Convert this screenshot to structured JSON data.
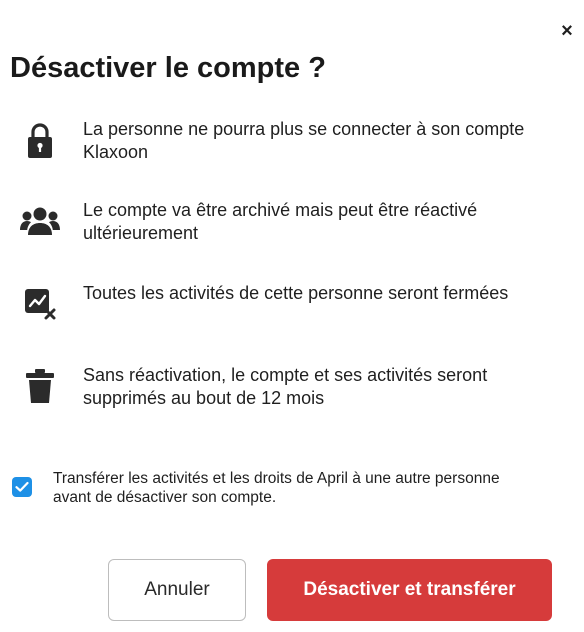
{
  "dialog": {
    "close_label": "×",
    "title": "Désactiver le compte ?",
    "items": [
      {
        "icon": "lock-icon",
        "text": "La personne ne pourra plus se connecter à son compte Klaxoon"
      },
      {
        "icon": "users-icon",
        "text": "Le compte va être archivé mais peut être réactivé ultérieurement"
      },
      {
        "icon": "activity-closed-icon",
        "text": "Toutes les activités de cette personne seront fermées"
      },
      {
        "icon": "trash-icon",
        "text": "Sans réactivation, le compte et ses activités seront supprimés au bout de 12 mois"
      }
    ],
    "transfer_checkbox": {
      "checked": true,
      "label": "Transférer les activités et les droits de April à une autre personne avant de désactiver son compte."
    },
    "buttons": {
      "cancel_label": "Annuler",
      "confirm_label": "Désactiver et transférer"
    },
    "colors": {
      "confirm": "#d63b3b",
      "checkbox": "#1e90e6",
      "icon": "#2b2b2b"
    }
  }
}
